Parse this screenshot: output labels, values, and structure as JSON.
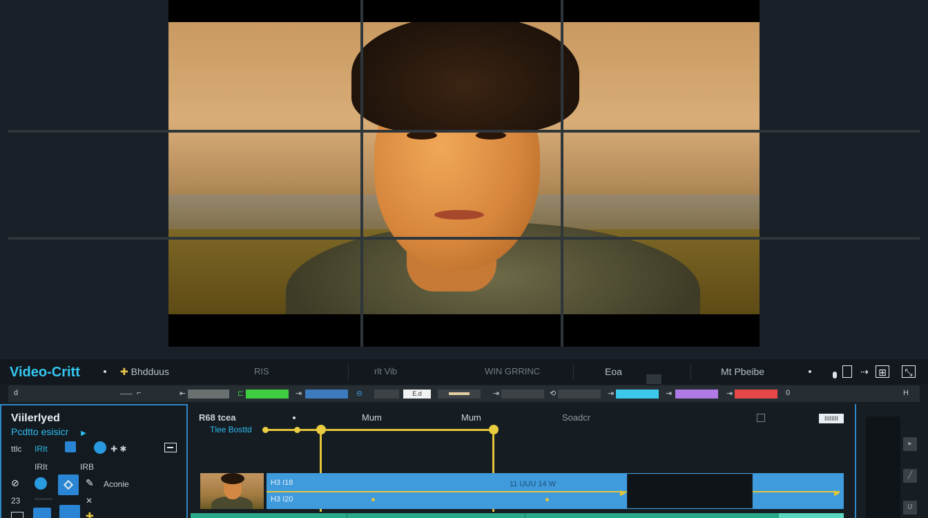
{
  "app": {
    "title": "Video-Critt"
  },
  "toolbar": {
    "menu_1": "Bhdduus",
    "menu_2": "Eoa",
    "menu_3": "Mt Pbeibe",
    "dim_1": "RIS",
    "dim_2": "rlt  Vib",
    "dim_3": "WIN GRRINC"
  },
  "strip": {
    "start_label": "d",
    "time_label": "E.d",
    "end_label": "0",
    "right_label": "H",
    "colors": {
      "gray": "#6a6f70",
      "green": "#3fce3f",
      "blue": "#3d7bbf",
      "white": "#f0f2f2",
      "cream": "#e4d0a2",
      "dark": "#3d4246",
      "cyan": "#3cc8ea",
      "purple": "#b07ae6",
      "red": "#e64848"
    }
  },
  "left_panel": {
    "title": "Viilerlyed",
    "subtitle": "Pcdtto esisicr",
    "row1_label": "ttlc",
    "row2_label_1": "IRIt",
    "row2_label_2": "IRB",
    "row3_label": "Aconie",
    "row4_label": "23"
  },
  "timeline": {
    "track_title": "R68 tcea",
    "track_sub": "Tlee Bosttd",
    "marker_1": "Mum",
    "marker_2": "Mum",
    "marker_3": "Soadcr",
    "tag": "IIIIIIII",
    "clip_label_1": "H3 I18",
    "clip_label_2": "H3 I20",
    "clip_mid_label": "11  UUU 14 W"
  },
  "icons": [
    "play-arrow-icon",
    "cursor-icon",
    "zoom-icon",
    "plus-icon",
    "gear-icon",
    "split-icon",
    "crop-icon",
    "link-icon",
    "pen-icon"
  ]
}
